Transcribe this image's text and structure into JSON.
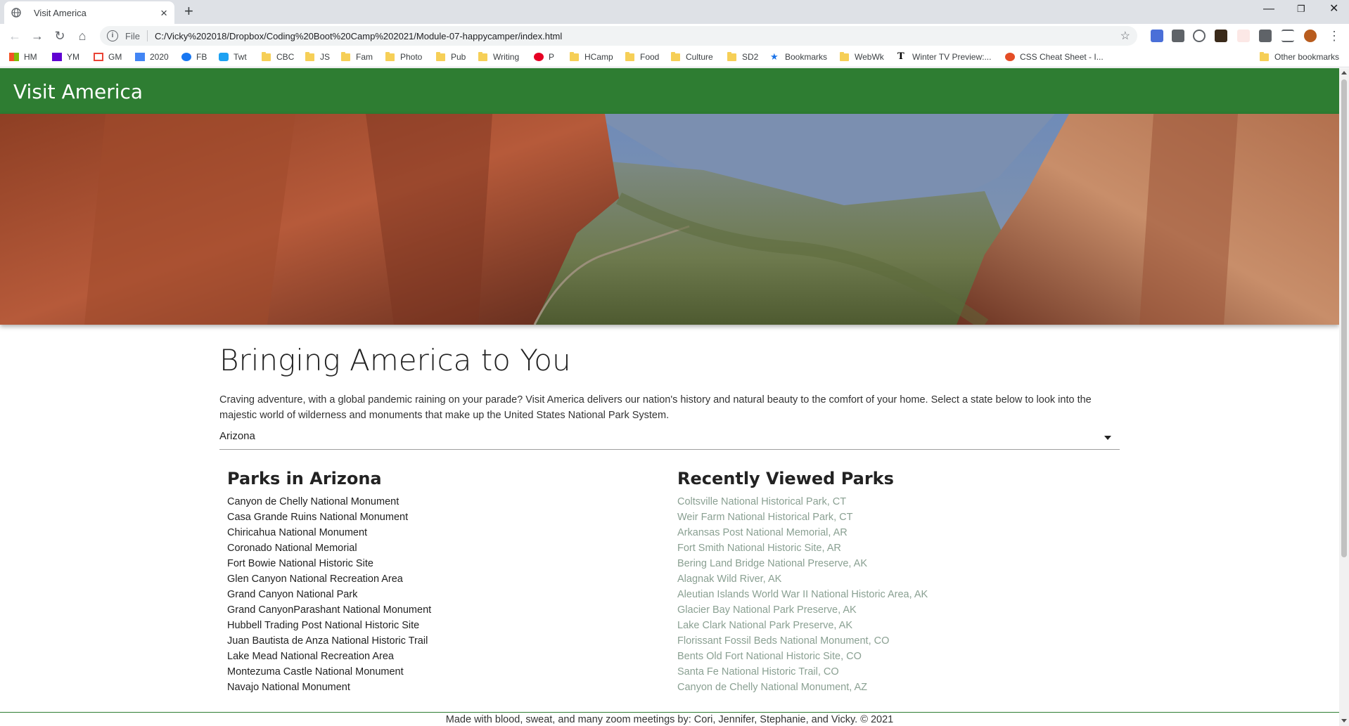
{
  "browser": {
    "tab_title": "Visit America",
    "address_prefix": "File",
    "url": "C:/Vicky%202018/Dropbox/Coding%20Boot%20Camp%202021/Module-07-happycamper/index.html",
    "bookmarks": [
      "HM",
      "YM",
      "GM",
      "2020",
      "FB",
      "Twt",
      "CBC",
      "JS",
      "Fam",
      "Photo",
      "Pub",
      "Writing",
      "P",
      "HCamp",
      "Food",
      "Culture",
      "SD2",
      "Bookmarks",
      "WebWk",
      "Winter TV Preview:...",
      "CSS Cheat Sheet - I...",
      "Other bookmarks"
    ]
  },
  "site": {
    "title": "Visit America",
    "headline": "Bringing America to You",
    "intro": "Craving adventure, with a global pandemic raining on your parade? Visit America delivers our nation's history and natural beauty to the comfort of your home. Select a state below to look into the majestic world of wilderness and monuments that make up the United States National Park System.",
    "selected_state": "Arizona",
    "parks_title": "Parks in Arizona",
    "parks": [
      "Canyon de Chelly National Monument",
      "Casa Grande Ruins National Monument",
      "Chiricahua National Monument",
      "Coronado National Memorial",
      "Fort Bowie National Historic Site",
      "Glen Canyon National Recreation Area",
      "Grand Canyon National Park",
      "Grand CanyonParashant National Monument",
      "Hubbell Trading Post National Historic Site",
      "Juan Bautista de Anza National Historic Trail",
      "Lake Mead National Recreation Area",
      "Montezuma Castle National Monument",
      "Navajo National Monument"
    ],
    "recent_title": "Recently Viewed Parks",
    "recent": [
      "Coltsville National Historical Park, CT",
      "Weir Farm National Historical Park, CT",
      "Arkansas Post National Memorial, AR",
      "Fort Smith National Historic Site, AR",
      "Bering Land Bridge National Preserve, AK",
      "Alagnak Wild River, AK",
      "Aleutian Islands World War II National Historic Area, AK",
      "Glacier Bay National Park Preserve, AK",
      "Lake Clark National Park Preserve, AK",
      "Florissant Fossil Beds National Monument, CO",
      "Bents Old Fort National Historic Site, CO",
      "Santa Fe National Historic Trail, CO",
      "Canyon de Chelly National Monument, AZ"
    ],
    "footer": "Made with blood, sweat, and many zoom meetings by: Cori, Jennifer, Stephanie, and Vicky. © 2021"
  },
  "colors": {
    "header_green": "#2e7d32",
    "recent_link": "#8aa092"
  }
}
